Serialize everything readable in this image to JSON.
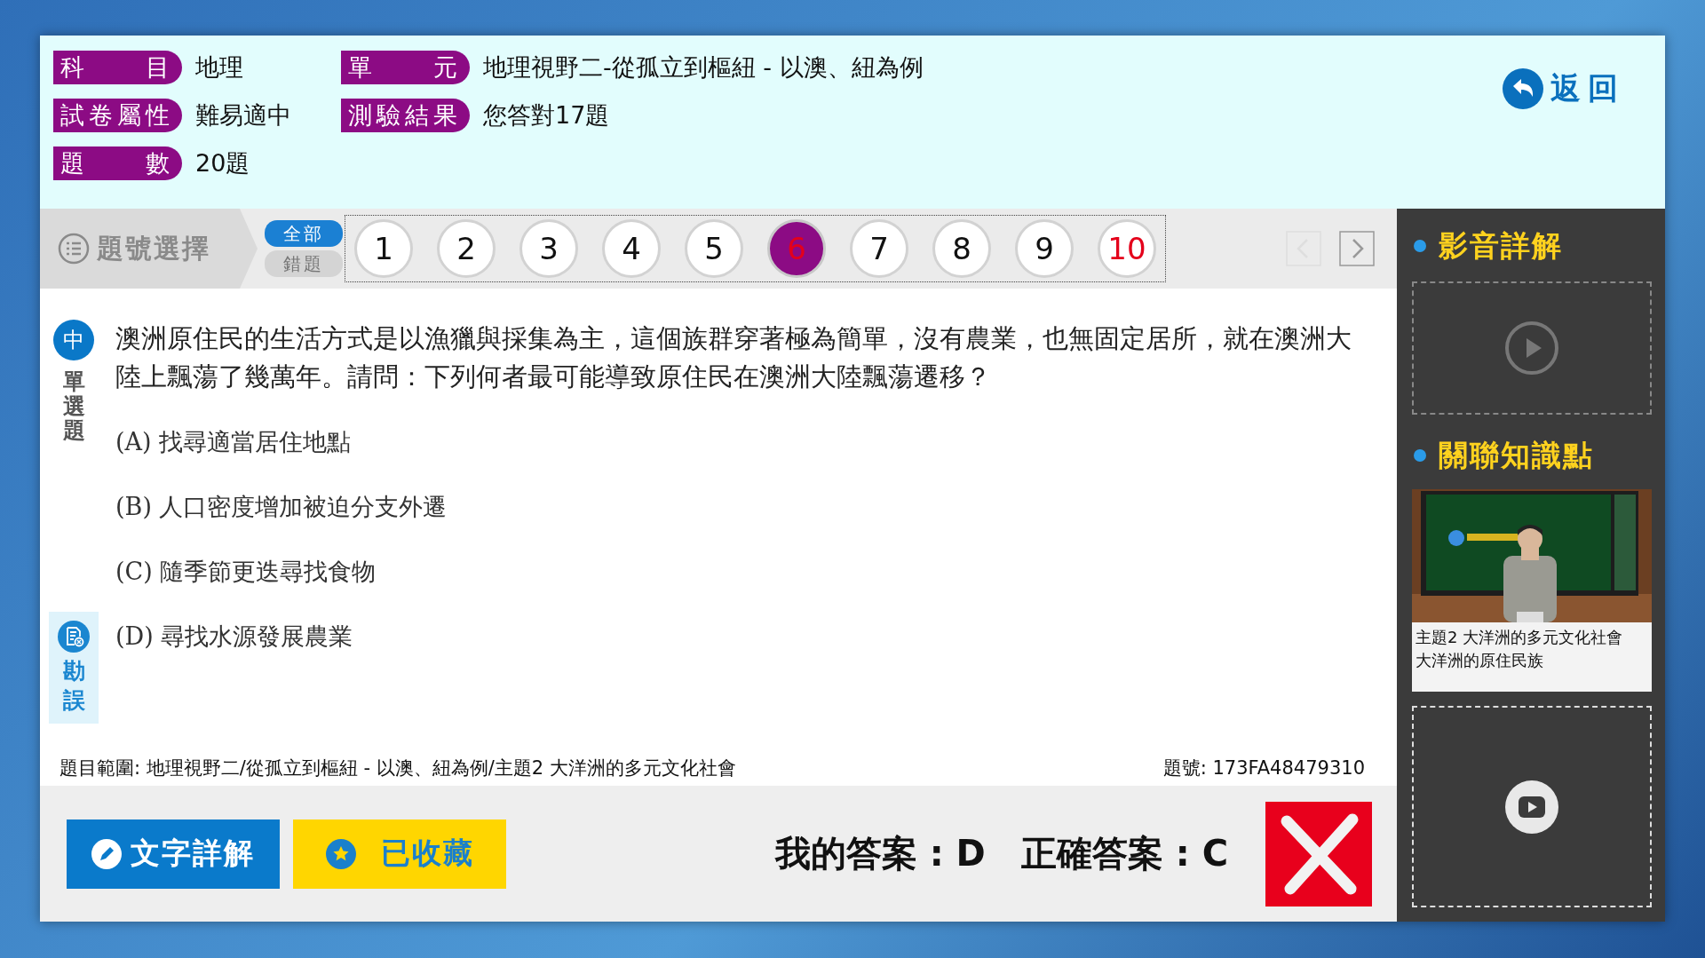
{
  "header": {
    "fields": [
      {
        "label": "科目",
        "value": "地理"
      },
      {
        "label": "單元",
        "value": "地理視野二-從孤立到樞紐 - 以澳、紐為例"
      },
      {
        "label": "試卷屬性",
        "value": "難易適中"
      },
      {
        "label": "測驗結果",
        "value": "您答對17題"
      },
      {
        "label": "題數",
        "value": "20題"
      }
    ],
    "back_button": "返回"
  },
  "nav": {
    "title": "題號選擇",
    "filters": [
      {
        "label": "全部",
        "selected": true
      },
      {
        "label": "錯題",
        "selected": false
      }
    ],
    "questions": [
      {
        "label": "1",
        "selected": false,
        "wrong": false
      },
      {
        "label": "2",
        "selected": false,
        "wrong": false
      },
      {
        "label": "3",
        "selected": false,
        "wrong": false
      },
      {
        "label": "4",
        "selected": false,
        "wrong": false
      },
      {
        "label": "5",
        "selected": false,
        "wrong": false
      },
      {
        "label": "6",
        "selected": true,
        "wrong": true
      },
      {
        "label": "7",
        "selected": false,
        "wrong": false
      },
      {
        "label": "8",
        "selected": false,
        "wrong": false
      },
      {
        "label": "9",
        "selected": false,
        "wrong": false
      },
      {
        "label": "10",
        "selected": false,
        "wrong": true
      }
    ],
    "prev_disabled": true,
    "next_disabled": false
  },
  "question": {
    "difficulty": "中",
    "type": "單選題",
    "text": "澳洲原住民的生活方式是以漁獵與採集為主，這個族群穿著極為簡單，沒有農業，也無固定居所，就在澳洲大陸上飄蕩了幾萬年。請問：下列何者最可能導致原住民在澳洲大陸飄蕩遷移？",
    "options": [
      "(A) 找尋適當居住地點",
      "(B) 人口密度增加被迫分支外遷",
      "(C) 隨季節更迭尋找食物",
      "(D) 尋找水源發展農業"
    ],
    "report_button": "勘誤",
    "scope": "題目範圍: 地理視野二/從孤立到樞紐 - 以澳、紐為例/主題2 大洋洲的多元文化社會",
    "code": "題號: 173FA48479310"
  },
  "footer": {
    "buttons": [
      {
        "kind": "explain",
        "label": "文字詳解"
      },
      {
        "kind": "bookmark",
        "label": "已收藏"
      }
    ],
    "my_answer": "我的答案 : D",
    "correct_answer": "正確答案 : C",
    "correct": false
  },
  "sidebar": {
    "video_heading": "影音詳解",
    "video_available": false,
    "related_heading": "關聯知識點",
    "related_items": [
      {
        "kind": "lesson",
        "title": "主題2 大洋洲的多元文化社會",
        "subtitle": "大洋洲的原住民族"
      },
      {
        "kind": "video",
        "available": true
      }
    ]
  }
}
